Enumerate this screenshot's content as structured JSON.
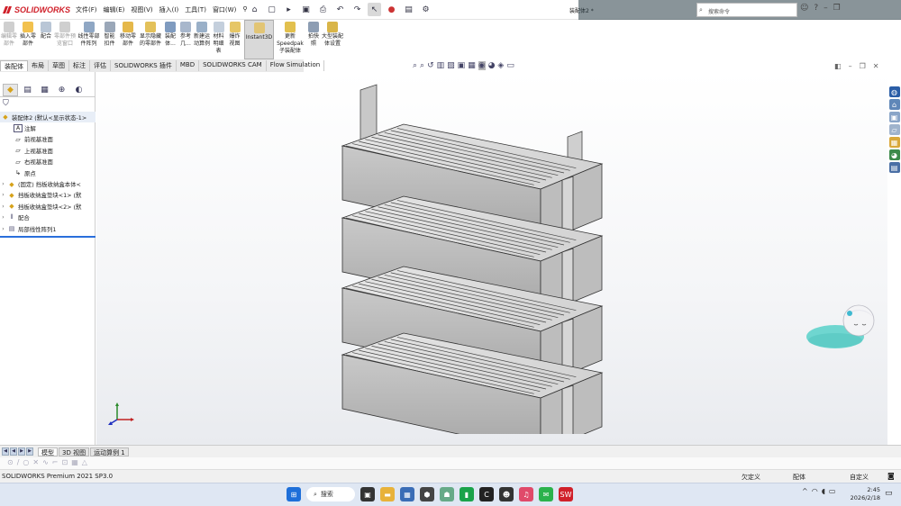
{
  "app": {
    "logo_brand": "SOLIDWORKS",
    "menus": [
      "文件(F)",
      "编辑(E)",
      "视图(V)",
      "插入(I)",
      "工具(T)",
      "窗口(W)"
    ],
    "document_title": "装配体2 *",
    "search_placeholder": "搜索命令"
  },
  "ribbon": {
    "buttons": [
      {
        "label": "编辑零部件",
        "enabled": false
      },
      {
        "label": "插入零部件",
        "enabled": true
      },
      {
        "label": "配合",
        "enabled": true
      },
      {
        "label": "零部件预览窗口",
        "enabled": false
      },
      {
        "label": "线性零部件阵列",
        "enabled": true
      },
      {
        "label": "智能扣件",
        "enabled": true
      },
      {
        "label": "移动零部件",
        "enabled": true
      },
      {
        "label": "显示隐藏的零部件",
        "enabled": true
      },
      {
        "label": "装配体...",
        "enabled": true
      },
      {
        "label": "参考几...",
        "enabled": true
      },
      {
        "label": "新建运动算例",
        "enabled": true
      },
      {
        "label": "材料明细表",
        "enabled": true
      },
      {
        "label": "爆炸视图",
        "enabled": true
      },
      {
        "label": "Instant3D",
        "enabled": true
      },
      {
        "label": "更新Speedpak子装配体",
        "enabled": true
      },
      {
        "label": "拍快照",
        "enabled": true
      },
      {
        "label": "大型装配体设置",
        "enabled": true
      }
    ]
  },
  "command_tabs": [
    "装配体",
    "布局",
    "草图",
    "标注",
    "评估",
    "SOLIDWORKS 插件",
    "MBD",
    "SOLIDWORKS CAM",
    "Flow Simulation"
  ],
  "feature_tree": {
    "root": "装配体2 (默认<显示状态-1>",
    "items": [
      {
        "label": "注解",
        "icon": "annotation-icon",
        "expandable": false
      },
      {
        "label": "前视基准面",
        "icon": "plane-icon",
        "expandable": false
      },
      {
        "label": "上视基准面",
        "icon": "plane-icon",
        "expandable": false
      },
      {
        "label": "右视基准面",
        "icon": "plane-icon",
        "expandable": false
      },
      {
        "label": "原点",
        "icon": "origin-icon",
        "expandable": false
      },
      {
        "label": "(固定) 挡板收纳盒本体<",
        "icon": "part-icon",
        "expandable": true
      },
      {
        "label": "挡板收纳盒垫块<1> (默",
        "icon": "part-icon",
        "expandable": true
      },
      {
        "label": "挡板收纳盒垫块<2> (默",
        "icon": "part-icon",
        "expandable": true
      },
      {
        "label": "配合",
        "icon": "mates-icon",
        "expandable": true
      },
      {
        "label": "局部线性阵列1",
        "icon": "pattern-icon",
        "expandable": true
      }
    ]
  },
  "bottom_tabs": [
    "模型",
    "3D 视图",
    "运动算例 1"
  ],
  "status": {
    "product": "SOLIDWORKS Premium 2021 SP3.0",
    "underdefined": "欠定义",
    "editing": "配体",
    "units": "自定义"
  },
  "taskbar": {
    "search_label": "搜索",
    "time": "2:45",
    "date": "2026/2/18"
  },
  "colors": {
    "brand_red": "#d0202a",
    "selection_blue": "#2a6fdb",
    "taskbar_bg": "#dfe7f3"
  }
}
